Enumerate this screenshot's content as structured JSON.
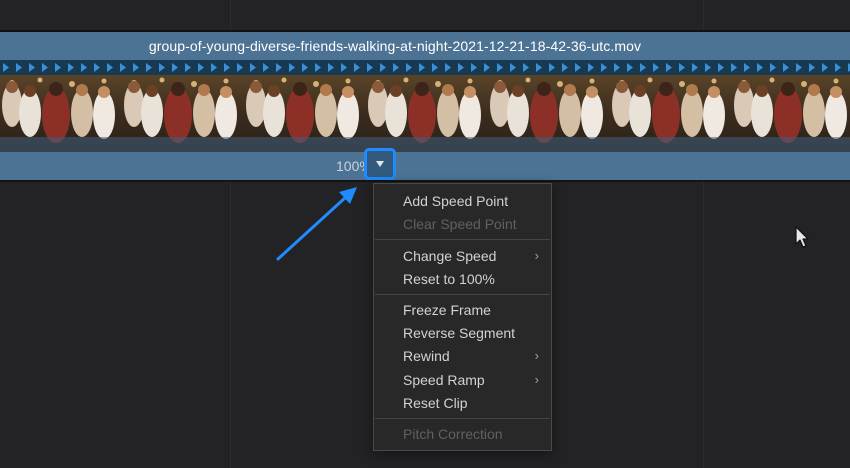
{
  "clip": {
    "filename": "group-of-young-diverse-friends-walking-at-night-2021-12-21-18-42-36-utc.mov",
    "speed_value": "100%"
  },
  "speed_menu": {
    "items": [
      {
        "label": "Add Speed Point",
        "enabled": true,
        "submenu": false
      },
      {
        "label": "Clear Speed Point",
        "enabled": false,
        "submenu": false
      },
      {
        "label": "Change Speed",
        "enabled": true,
        "submenu": true
      },
      {
        "label": "Reset to 100%",
        "enabled": true,
        "submenu": false
      },
      {
        "label": "Freeze Frame",
        "enabled": true,
        "submenu": false
      },
      {
        "label": "Reverse Segment",
        "enabled": true,
        "submenu": false
      },
      {
        "label": "Rewind",
        "enabled": true,
        "submenu": true
      },
      {
        "label": "Speed Ramp",
        "enabled": true,
        "submenu": true
      },
      {
        "label": "Reset Clip",
        "enabled": true,
        "submenu": false
      },
      {
        "label": "Pitch Correction",
        "enabled": false,
        "submenu": false
      }
    ],
    "submenu_glyph": "›"
  },
  "colors": {
    "accent": "#1f8bff",
    "clip_header": "#4d7394",
    "background": "#232326"
  },
  "icons": {
    "dropdown": "triangle-down-icon",
    "annotation": "blue-arrow-icon",
    "cursor": "mouse-pointer-icon"
  }
}
